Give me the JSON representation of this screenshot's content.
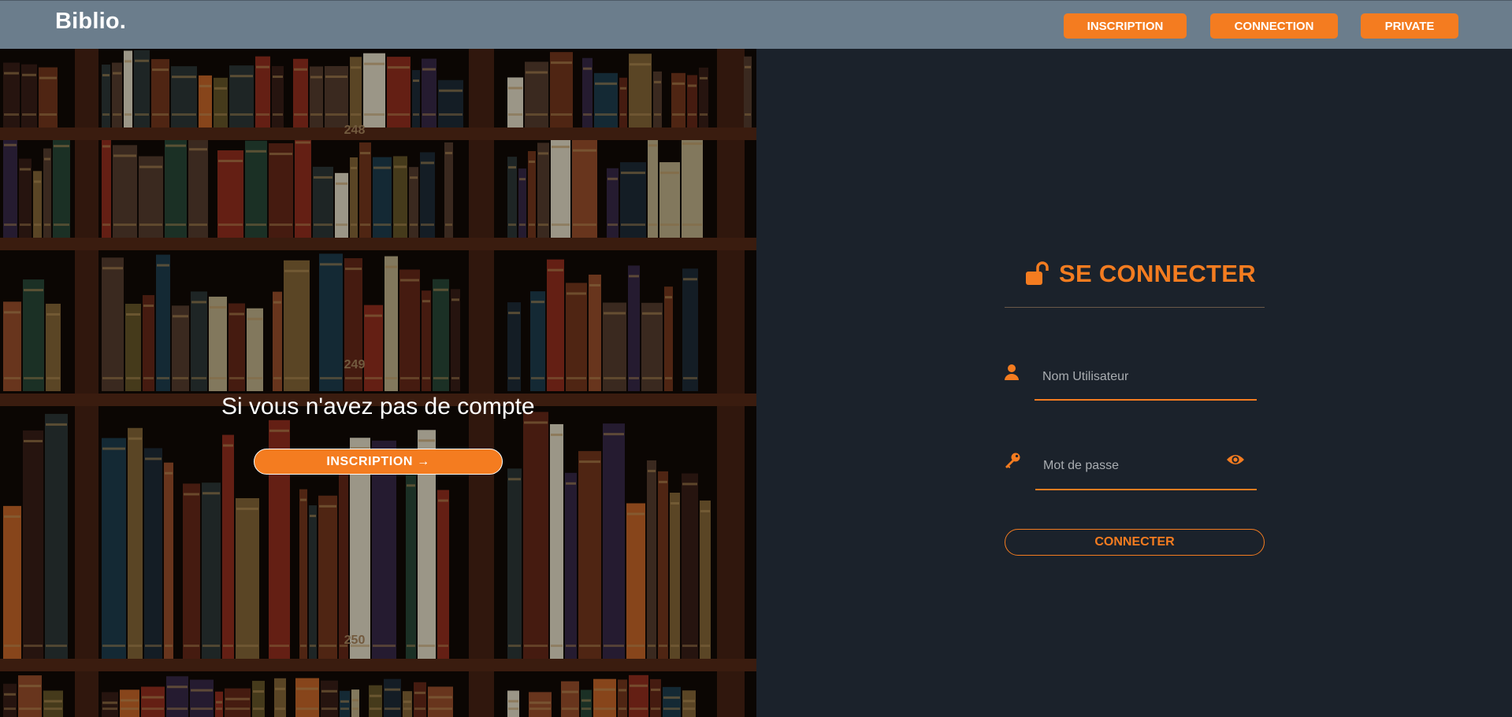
{
  "header": {
    "logo": "Biblio.",
    "nav": [
      {
        "label": "INSCRIPTION"
      },
      {
        "label": "CONNECTION"
      },
      {
        "label": "PRIVATE"
      }
    ]
  },
  "hero": {
    "text": "Si vous n'avez pas de compte",
    "button_label": "INSCRIPTION →",
    "shelf_numbers": [
      "248",
      "249",
      "250"
    ]
  },
  "login": {
    "title": "SE CONNECTER",
    "username_placeholder": "Nom Utilisateur",
    "password_placeholder": "Mot de passe",
    "submit_label": "CONNECTER"
  },
  "colors": {
    "accent": "#f47c20",
    "header_bg": "#6b7d8c",
    "panel_bg": "#1b222b"
  },
  "icons": [
    "unlock-icon",
    "user-icon",
    "key-icon",
    "eye-icon",
    "arrow-right-icon"
  ]
}
